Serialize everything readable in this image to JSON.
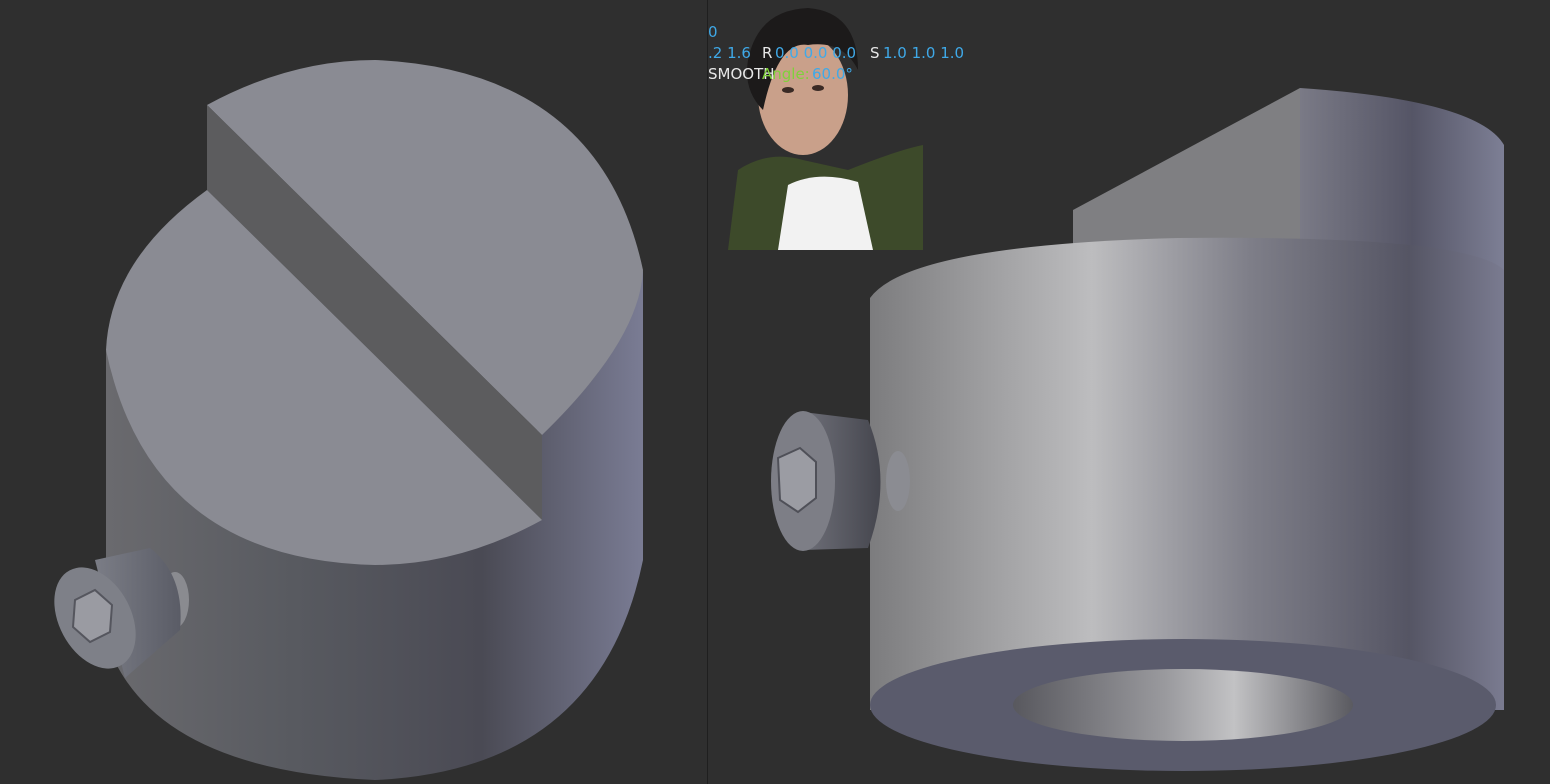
{
  "overlay": {
    "frame_value": "0",
    "location_tail": ".2 1.6",
    "rotation_label": "R",
    "rotation_values": "0.0 0.0 0.0",
    "scale_label": "S",
    "scale_values": "1.0 1.0 1.0",
    "shading_mode": "SMOOTH",
    "angle_label": "Angle:",
    "angle_value": "60.0°"
  },
  "colors": {
    "background": "#2f2f2f",
    "value_blue": "#3fa9e8",
    "label_white": "#e8e8e8",
    "angle_green": "#7fd13b"
  }
}
